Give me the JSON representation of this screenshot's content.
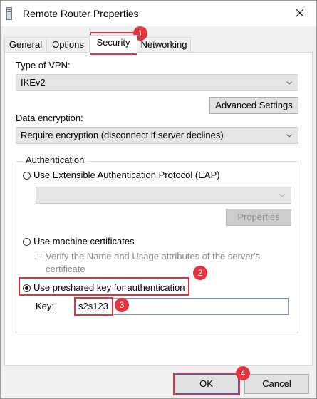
{
  "window": {
    "title": "Remote Router Properties"
  },
  "tabs": [
    {
      "label": "General"
    },
    {
      "label": "Options"
    },
    {
      "label": "Security"
    },
    {
      "label": "Networking"
    }
  ],
  "security": {
    "vpn_type_label": "Type of VPN:",
    "vpn_type_value": "IKEv2",
    "advanced_settings_label": "Advanced Settings",
    "encryption_label": "Data encryption:",
    "encryption_value": "Require encryption (disconnect if server declines)",
    "auth_group_label": "Authentication",
    "eap_label": "Use Extensible Authentication Protocol (EAP)",
    "eap_properties_label": "Properties",
    "machine_certs_label": "Use machine certificates",
    "verify_name_label_line1": "Verify the Name and Usage attributes of the server's",
    "verify_name_label_line2": "certificate",
    "preshared_label": "Use preshared key for authentication",
    "key_label": "Key:",
    "key_value": "s2s123"
  },
  "footer": {
    "ok_label": "OK",
    "cancel_label": "Cancel"
  },
  "annotations": {
    "badges": [
      "1",
      "2",
      "3",
      "4"
    ],
    "highlight_color": "#e5343e"
  },
  "icons": {
    "title_icon": "server-icon",
    "close": "close-icon",
    "dropdown": "chevron-down-icon"
  }
}
